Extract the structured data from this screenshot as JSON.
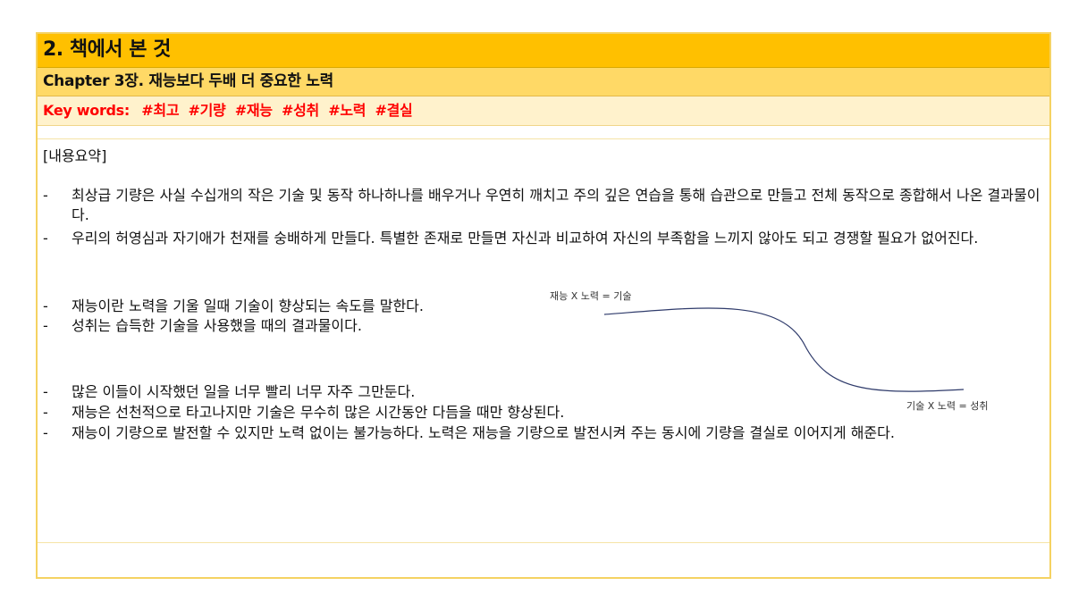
{
  "header": {
    "title": "2. 책에서 본 것",
    "chapter": "Chapter 3장. 재능보다 두배 더 중요한 노력",
    "keywords_label": "Key words:",
    "keywords": [
      "#최고",
      "#기량",
      "#재능",
      "#성취",
      "#노력",
      "#결실"
    ]
  },
  "summary": {
    "heading": "[내용요약]",
    "bullet_marker": "-",
    "bullets": [
      "최상급 기량은 사실 수십개의 작은 기술 및 동작 하나하나를 배우거나 우연히 깨치고 주의 깊은 연습을 통해 습관으로 만들고 전체 동작으로 종합해서 나온 결과물이다.",
      "우리의 허영심과 자기애가 천재를 숭배하게 만들다. 특별한 존재로 만들면 자신과 비교하여 자신의 부족함을 느끼지 않아도 되고 경쟁할 필요가 없어진다.",
      "재능이란 노력을 기울 일때 기술이 향상되는 속도를 말한다.",
      "성취는 습득한 기술을 사용했을 때의 결과물이다.",
      "많은 이들이 시작했던 일을 너무 빨리 너무 자주 그만둔다.",
      "재능은 선천적으로 타고나지만 기술은 무수히 많은 시간동안 다듬을 때만 향상된다.",
      "재능이 기량으로 발전할 수 있지만 노력 없이는 불가능하다. 노력은 재능을 기량으로 발전시켜 주는 동시에 기량을 결실로 이어지게 해준다."
    ]
  },
  "diagram": {
    "label_top": "재능 X 노력 = 기술",
    "label_bottom": "기술 X 노력 = 성취",
    "line_color": "#2f3b6b"
  }
}
